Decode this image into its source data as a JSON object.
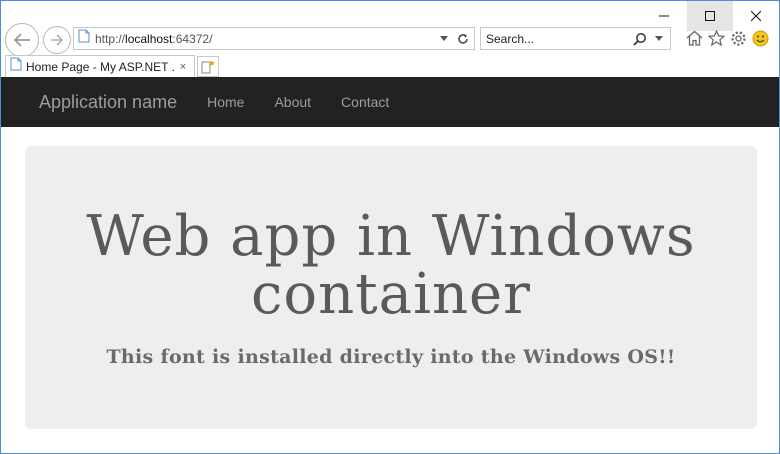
{
  "browser": {
    "url_prefix": "http://",
    "url_host": "localhost",
    "url_port": ":64372/",
    "search_placeholder": "Search...",
    "tab_title": "Home Page - My ASP.NET ...",
    "tab_close": "×"
  },
  "site": {
    "brand": "Application name",
    "nav": [
      "Home",
      "About",
      "Contact"
    ]
  },
  "hero": {
    "title": "Web app in Windows container",
    "subtitle": "This font is installed directly into the Windows OS!!"
  },
  "colors": {
    "navbar_bg": "#222222",
    "nav_text": "#9d9d9d",
    "jumbotron_bg": "#eeeeee"
  }
}
